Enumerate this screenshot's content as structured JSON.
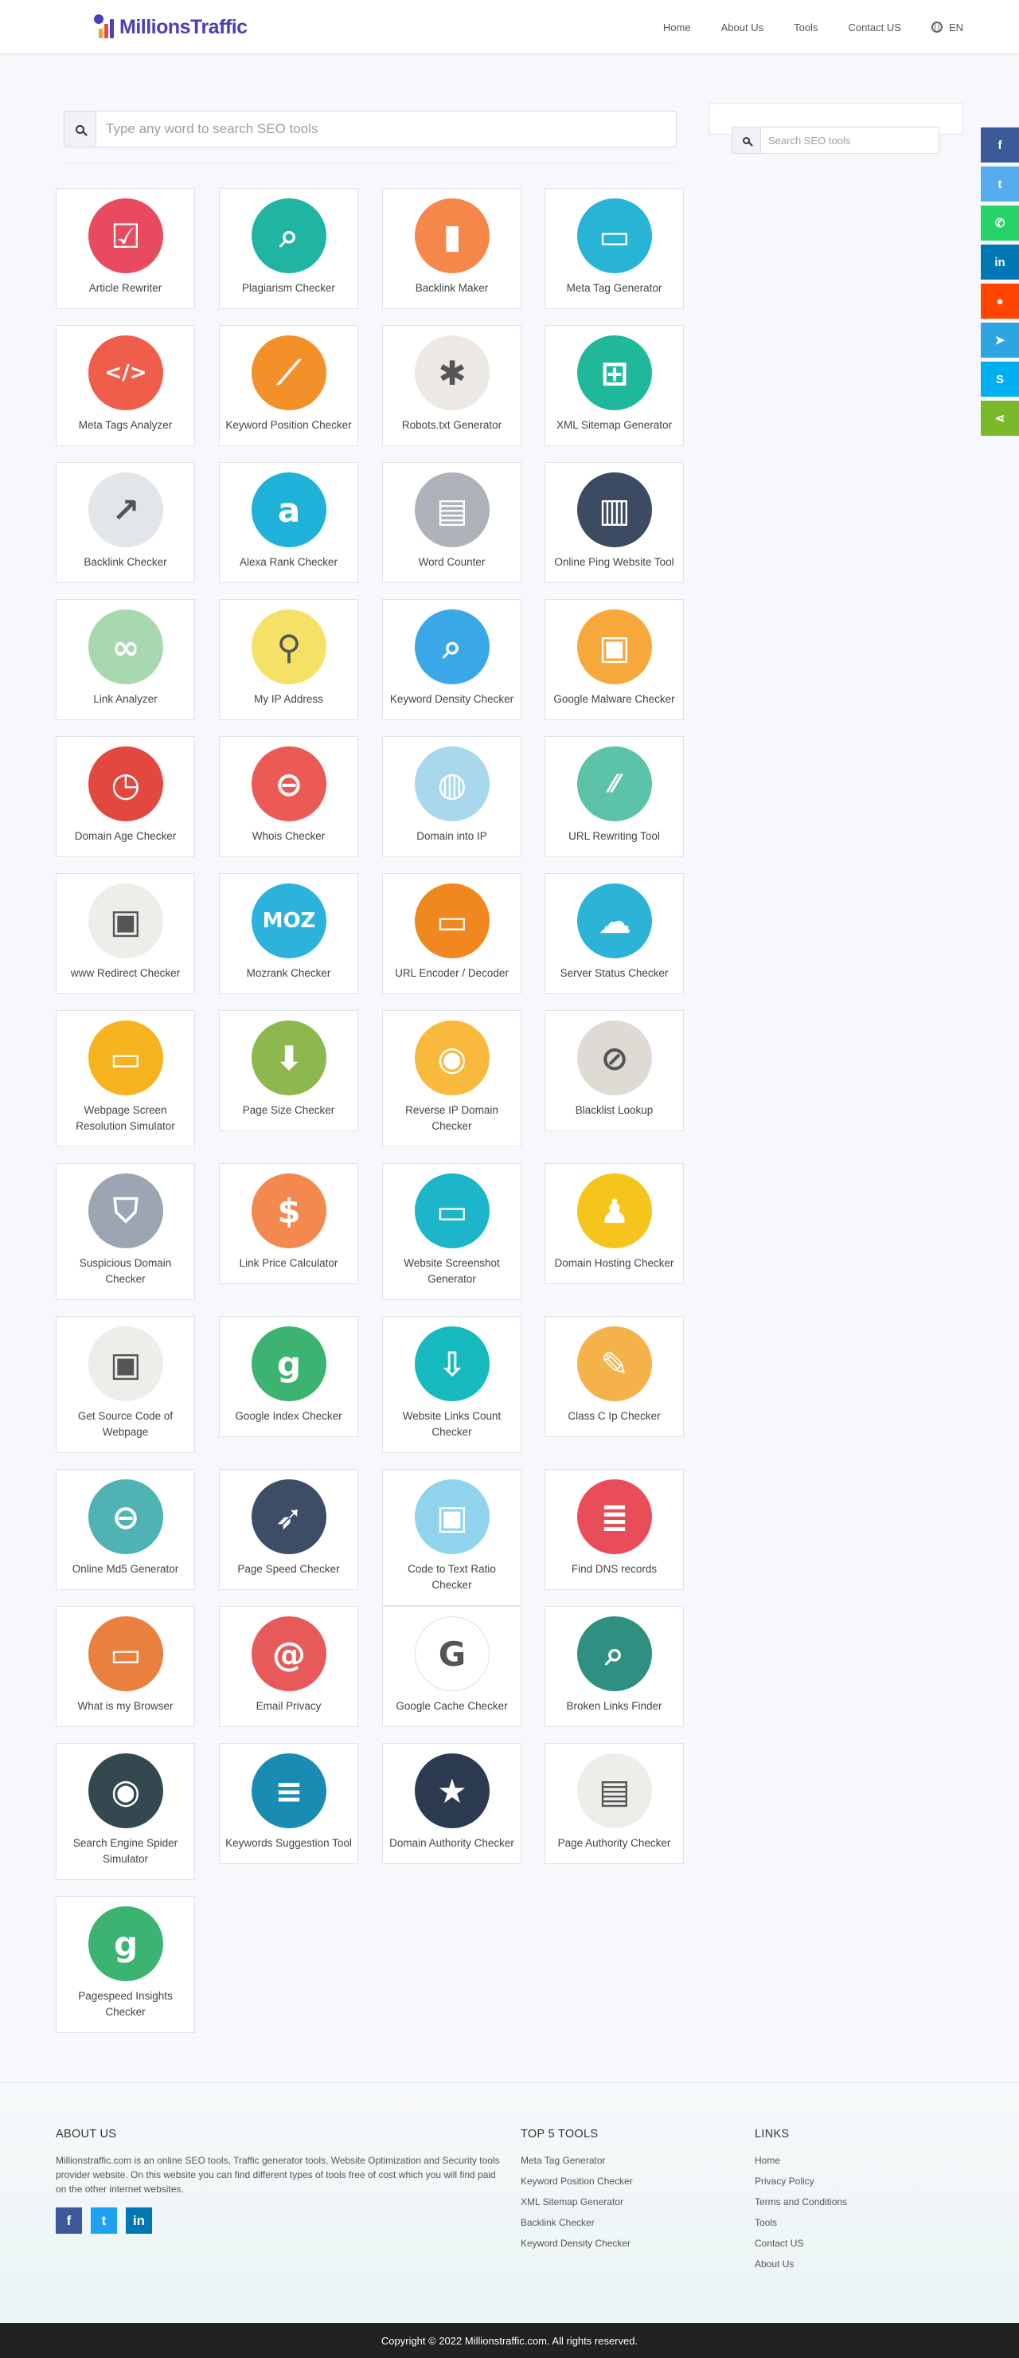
{
  "header": {
    "brand": "MillionsTraffic",
    "nav": [
      "Home",
      "About Us",
      "Tools",
      "Contact US"
    ],
    "language": "EN"
  },
  "search": {
    "placeholder": "Type any word to search SEO tools"
  },
  "sidebar": {
    "search_placeholder": "Search SEO tools"
  },
  "share": [
    "f",
    "t",
    "w",
    "in",
    "r",
    "tg",
    "s",
    "sh"
  ],
  "tools": [
    {
      "label": "Article Rewriter",
      "icon": "checklist-icon",
      "color": "#e84a5f"
    },
    {
      "label": "Plagiarism Checker",
      "icon": "magnifier-document-icon",
      "color": "#1fb5a2"
    },
    {
      "label": "Backlink Maker",
      "icon": "bar-chart-icon",
      "color": "#f6874b"
    },
    {
      "label": "Meta Tag Generator",
      "icon": "monitor-icon",
      "color": "#28b4d6"
    },
    {
      "label": "Meta Tags Analyzer",
      "icon": "code-brackets-icon",
      "color": "#ef5d4b"
    },
    {
      "label": "Keyword Position Checker",
      "icon": "line-chart-icon",
      "color": "#f3902a"
    },
    {
      "label": "Robots.txt Generator",
      "icon": "robot-bug-icon",
      "color": "#ece8e3"
    },
    {
      "label": "XML Sitemap Generator",
      "icon": "sitemap-icon",
      "color": "#1fb89a"
    },
    {
      "label": "Backlink Checker",
      "icon": "growth-chart-icon",
      "color": "#e2e6ea"
    },
    {
      "label": "Alexa Rank Checker",
      "icon": "alexa-icon",
      "color": "#1fb2d9"
    },
    {
      "label": "Word Counter",
      "icon": "document-icon",
      "color": "#aeb3b9"
    },
    {
      "label": "Online Ping Website Tool",
      "icon": "bar-graph-icon",
      "color": "#3c4a62"
    },
    {
      "label": "Link Analyzer",
      "icon": "chain-link-icon",
      "color": "#a8d8b0"
    },
    {
      "label": "My IP Address",
      "icon": "map-pin-icon",
      "color": "#f6e167"
    },
    {
      "label": "Keyword Density Checker",
      "icon": "search-magnifier-icon",
      "color": "#3aa8e8"
    },
    {
      "label": "Google Malware Checker",
      "icon": "browser-bug-icon",
      "color": "#f6a93a"
    },
    {
      "label": "Domain Age Checker",
      "icon": "clock-icon",
      "color": "#e2483f"
    },
    {
      "label": "Whois Checker",
      "icon": "padlock-icon",
      "color": "#ec5a55"
    },
    {
      "label": "Domain into IP",
      "icon": "globe-ip-icon",
      "color": "#a9d8ec"
    },
    {
      "label": "URL Rewriting Tool",
      "icon": "http-icon",
      "color": "#5cc3a8"
    },
    {
      "label": "www Redirect Checker",
      "icon": "browser-www-icon",
      "color": "#efedea"
    },
    {
      "label": "Mozrank Checker",
      "icon": "moz-icon",
      "color": "#2bb3dc"
    },
    {
      "label": "URL Encoder / Decoder",
      "icon": "www-cursor-icon",
      "color": "#f0881f"
    },
    {
      "label": "Server Status Checker",
      "icon": "cloud-server-icon",
      "color": "#2bb4d8"
    },
    {
      "label": "Webpage Screen Resolution Simulator",
      "icon": "devices-icon",
      "color": "#f6b31d"
    },
    {
      "label": "Page Size Checker",
      "icon": "download-tray-icon",
      "color": "#8cb84e"
    },
    {
      "label": "Reverse IP Domain Checker",
      "icon": "ip-router-icon",
      "color": "#f8b93d"
    },
    {
      "label": "Blacklist Lookup",
      "icon": "ban-icon",
      "color": "#dedbd4"
    },
    {
      "label": "Suspicious Domain Checker",
      "icon": "shield-icon",
      "color": "#9ca6b2"
    },
    {
      "label": "Link Price Calculator",
      "icon": "money-hand-icon",
      "color": "#f3894e"
    },
    {
      "label": "Website Screenshot Generator",
      "icon": "screenshot-browser-icon",
      "color": "#1db5c9"
    },
    {
      "label": "Domain Hosting Checker",
      "icon": "linux-penguin-icon",
      "color": "#f6c51d"
    },
    {
      "label": "Get Source Code of Webpage",
      "icon": "html-browser-icon",
      "color": "#efedea"
    },
    {
      "label": "Google Index Checker",
      "icon": "google-plus-search-icon",
      "color": "#3cb371"
    },
    {
      "label": "Website Links Count Checker",
      "icon": "links-download-icon",
      "color": "#16b9be"
    },
    {
      "label": "Class C Ip Checker",
      "icon": "class-c-wrench-icon",
      "color": "#f6b24a"
    },
    {
      "label": "Online Md5 Generator",
      "icon": "lock-icon",
      "color": "#4fb3b4"
    },
    {
      "label": "Page Speed Checker",
      "icon": "rocket-icon",
      "color": "#3d4d65"
    },
    {
      "label": "Code to Text Ratio Checker",
      "icon": "code-window-icon",
      "color": "#8fd3ec"
    },
    {
      "label": "Find DNS records",
      "icon": "server-rack-icon",
      "color": "#ea4d5a"
    },
    {
      "label": "What is my Browser",
      "icon": "browser-window-icon",
      "color": "#e9803d"
    },
    {
      "label": "Email Privacy",
      "icon": "at-sign-icon",
      "color": "#e85a5a"
    },
    {
      "label": "Google Cache Checker",
      "icon": "google-cache-icon",
      "color": "#ffffff"
    },
    {
      "label": "Broken Links Finder",
      "icon": "404-magnifier-icon",
      "color": "#2f8f80"
    },
    {
      "label": "Search Engine Spider Simulator",
      "icon": "spider-robot-icon",
      "color": "#34494f"
    },
    {
      "label": "Keywords Suggestion Tool",
      "icon": "books-icon",
      "color": "#1a8cb2"
    },
    {
      "label": "Domain Authority Checker",
      "icon": "domain-authority-icon",
      "color": "#2b3a4e"
    },
    {
      "label": "Page Authority Checker",
      "icon": "page-icon",
      "color": "#efedea"
    },
    {
      "label": "Pagespeed Insights Checker",
      "icon": "google-plus-search-icon",
      "color": "#3cb371"
    }
  ],
  "footer": {
    "about_title": "ABOUT US",
    "about_text": "Millionstraffic.com is an online SEO tools, Traffic generator tools, Website Optimization and Security tools provider website. On this website you can find different types of tools free of cost which you will find paid on the other internet websites.",
    "top5_title": "TOP 5 TOOLS",
    "top5": [
      "Meta Tag Generator",
      "Keyword Position Checker",
      "XML Sitemap Generator",
      "Backlink Checker",
      "Keyword Density Checker"
    ],
    "links_title": "LINKS",
    "links": [
      "Home",
      "Privacy Policy",
      "Terms and Conditions",
      "Tools",
      "Contact US",
      "About Us"
    ],
    "socials": [
      "f",
      "t",
      "in"
    ],
    "copyright": "Copyright © 2022 Millionstraffic.com. All rights reserved."
  }
}
